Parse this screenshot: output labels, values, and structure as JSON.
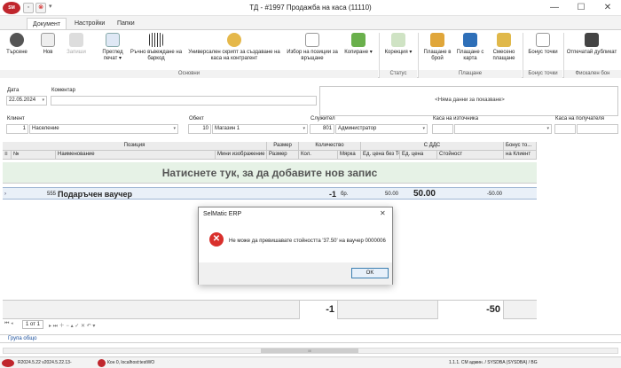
{
  "window": {
    "title": "ТД - #1997 Продажба на каса (11110)",
    "logo_text": "SM",
    "minimize": "—",
    "maximize": "☐",
    "close": "✕"
  },
  "tabs": [
    {
      "label": "Документ"
    },
    {
      "label": "Настройки"
    },
    {
      "label": "Папки"
    }
  ],
  "ribbon": {
    "buttons": [
      {
        "label": "Търсене"
      },
      {
        "label": "Нов"
      },
      {
        "label": "Запиши"
      },
      {
        "label": "Преглед печат ▾"
      },
      {
        "label": "Ръчно въвеждане на баркод"
      },
      {
        "label": "Универсален скрипт за създаване на каса на контрагент"
      },
      {
        "label": "Избор на позиции за връщане"
      },
      {
        "label": "Копиране ▾"
      },
      {
        "label": "Корекция ▾"
      },
      {
        "label": "Плащане в брой"
      },
      {
        "label": "Плащане с карта"
      },
      {
        "label": "Смесено плащане"
      },
      {
        "label": "Бонус точки"
      },
      {
        "label": "Отпечатай дубликат"
      }
    ],
    "groups": {
      "main": "Основни",
      "status": "Статус",
      "payment": "Плащане",
      "bonus": "Бонус точки",
      "fiscal": "Фискален бон"
    }
  },
  "form": {
    "date_label": "Дата",
    "date_value": "22.05.2024",
    "comment_label": "Коментар",
    "comment_value": "",
    "no_data": "<Няма данни за показване>",
    "client_label": "Клиент",
    "client_code": "1",
    "client_name": "Население",
    "object_label": "Обект",
    "object_code": "10",
    "object_name": "Магазин 1",
    "employee_label": "Служител",
    "employee_code": "801",
    "employee_name": "Администратор",
    "source_cash_label": "Каса на източника",
    "recipient_cash_label": "Каса на получателя"
  },
  "grid": {
    "group_headers": {
      "position": "Позиция",
      "size": "Размер",
      "quantity": "Количество",
      "vat": "С ДДС",
      "bonus": "Бонус то..."
    },
    "columns": {
      "num": "№",
      "name": "Наименование",
      "mini_image": "Мини изображение",
      "size": "Размер",
      "qty": "Кол.",
      "unit": "Мярка",
      "price_no_vat": "Ед. цена без ТО",
      "price": "Ед. цена",
      "value": "Стойност",
      "bonus_client": "на Клиент"
    },
    "new_row_prompt": "Натиснете тук, за да добавите нов запис",
    "rows": [
      {
        "code": "555",
        "name": "Подаръчен ваучер",
        "qty": "-1",
        "unit": "бр.",
        "price_no_vat": "50.00",
        "price": "50.00",
        "value": "-50.00"
      }
    ],
    "footer": {
      "qty_total": "-1",
      "value_total": "-50"
    },
    "nav": {
      "page": "1 от 1"
    }
  },
  "group_label": "Група общо",
  "scroll_label": "III",
  "statusbar": {
    "version": "R2024.5.22 v2024.5.22.13-",
    "connection": "Кон 0, localhost:testWO",
    "user": "1.1.1. СМ админ. / SYSDBA (SYSDBA) / BG"
  },
  "dialog": {
    "title": "SelMatic ERP",
    "close": "✕",
    "message": "Не може да превишавате стойността '37.50' на ваучер 0000006",
    "ok": "OK"
  },
  "colors": {
    "accent": "#c0262d",
    "error": "#d9302c",
    "newrow_bg": "#e6f2e6"
  }
}
